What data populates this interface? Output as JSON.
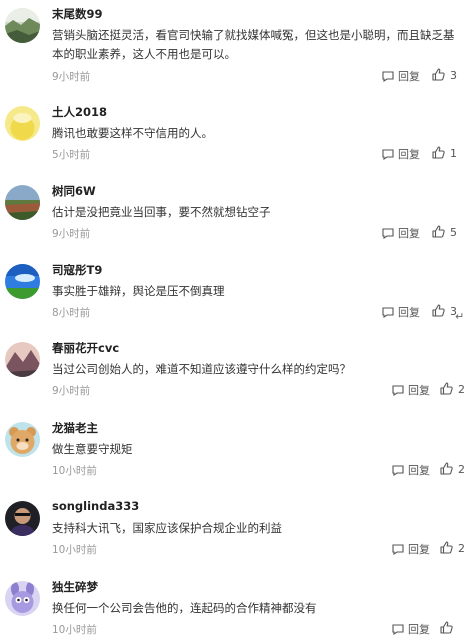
{
  "comments": [
    {
      "username": "末尾数99",
      "text": "营销头脑还挺灵活，看官司快输了就找媒体喊冤，但这也是小聪明，而且缺乏基本的职业素养，这人不用也是可以。",
      "time": "9小时前",
      "reply": "回复",
      "likes": "3",
      "avatar": "avatar-landscape-icon"
    },
    {
      "username": "土人2018",
      "text": "腾讯也敢要这样不守信用的人。",
      "time": "5小时前",
      "reply": "回复",
      "likes": "1",
      "avatar": "avatar-yellow-icon"
    },
    {
      "username": "树同6W",
      "text": "估计是没把竟业当回事，要不然就想钻空子",
      "time": "9小时前",
      "reply": "回复",
      "likes": "5",
      "avatar": "avatar-field-icon"
    },
    {
      "username": "司寇彤T9",
      "text": "事实胜于雄辩，舆论是压不倒真理",
      "time": "8小时前",
      "reply": "回复",
      "likes": "3",
      "avatar": "avatar-sky-icon"
    },
    {
      "username": "春丽花开cvc",
      "text": "当过公司创始人的，难道不知道应该遵守什么样的约定吗？",
      "time": "9小时前",
      "reply": "回复",
      "likes": "2",
      "avatar": "avatar-mountain-icon"
    },
    {
      "username": "龙猫老主",
      "text": "做生意要守规矩",
      "time": "10小时前",
      "reply": "回复",
      "likes": "2",
      "avatar": "avatar-bear-icon"
    },
    {
      "username": "songlinda333",
      "text": "支持科大讯飞，国家应该保护合规企业的利益",
      "time": "10小时前",
      "reply": "回复",
      "likes": "2",
      "avatar": "avatar-person-icon"
    },
    {
      "username": "独生碎梦",
      "text": "换任何一个公司会告他的，连起码的合作精神都没有",
      "time": "10小时前",
      "reply": "回复",
      "likes": "",
      "avatar": "avatar-cartoon-icon"
    }
  ],
  "colors": {
    "text": "#333333",
    "time": "#999999",
    "action": "#555555"
  }
}
